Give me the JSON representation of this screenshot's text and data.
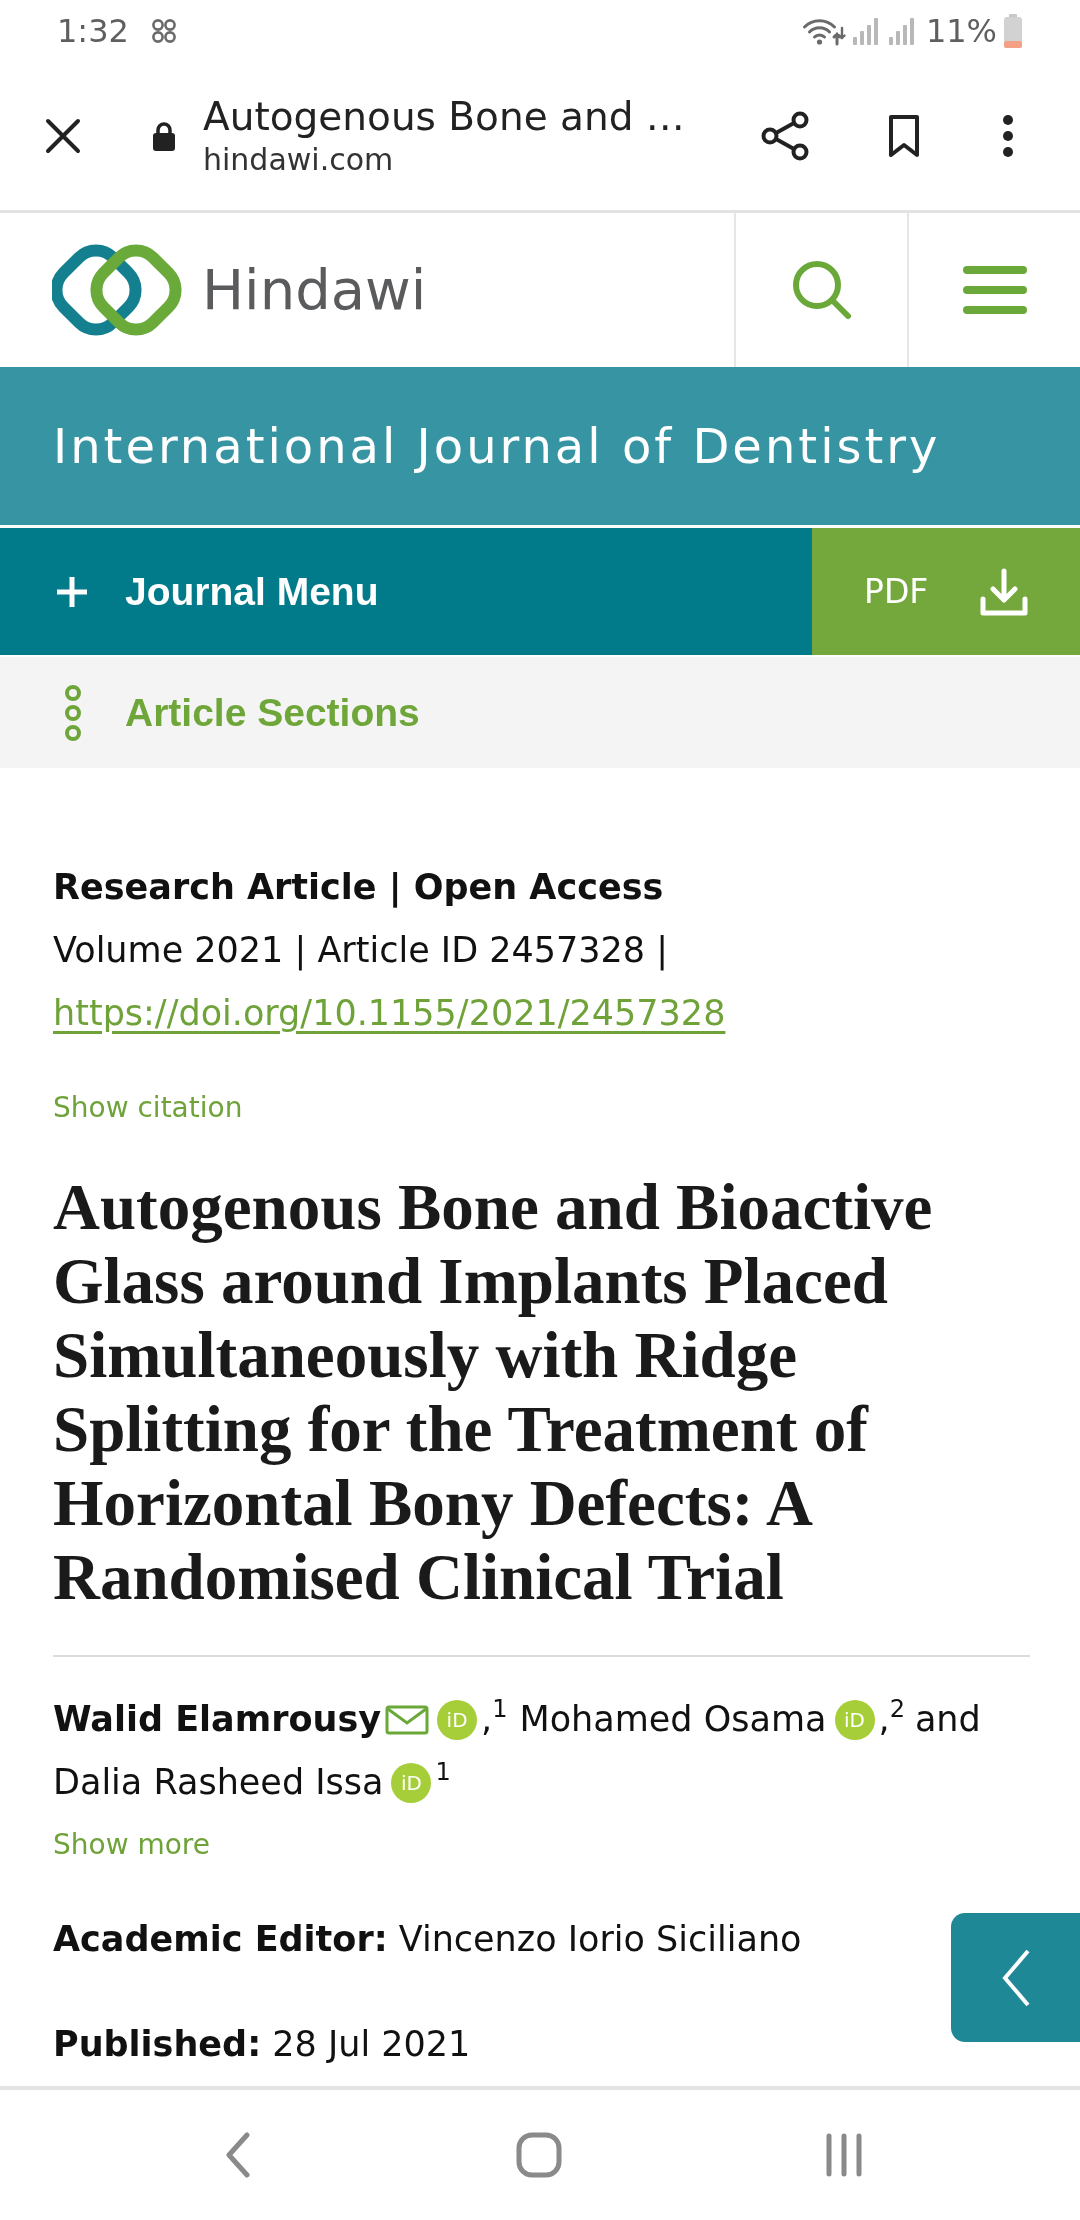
{
  "status_bar": {
    "time": "1:32",
    "battery": "11%"
  },
  "browser_bar": {
    "title": "Autogenous Bone and …",
    "url": "hindawi.com"
  },
  "site_header": {
    "brand": "Hindawi"
  },
  "journal_banner": {
    "title": "International Journal of Dentistry"
  },
  "action_bar": {
    "menu_label": "Journal Menu",
    "pdf_label": "PDF"
  },
  "sections_bar": {
    "label": "Article Sections"
  },
  "article": {
    "type_line": "Research Article | Open Access",
    "volume_line": "Volume 2021 | Article ID 2457328 |",
    "doi": "https://doi.org/10.1155/2021/2457328",
    "citation_link": "Show citation",
    "title": "Autogenous Bone and Bioactive Glass around Implants Placed Simultaneously with Ridge Splitting for the Treatment of Horizontal Bony Defects: A Randomised Clinical Trial",
    "authors": [
      {
        "name": "Walid Elamrousy",
        "corresponding": true,
        "orcid": "iD",
        "mark": ",$^{1}$"
      },
      {
        "name": "Mohamed Osama",
        "corresponding": false,
        "orcid": "iD",
        "mark": ",$^{2}$",
        "conjunction": "and"
      },
      {
        "name": "Dalia Rasheed Issa",
        "corresponding": false,
        "orcid": "iD",
        "mark": "$^{1}$"
      }
    ],
    "show_more": "Show more",
    "details": [
      "**Academic Editor:** Vincenzo Iorio Siciliano",
      "**Published:** 28 Jul 2021"
    ]
  }
}
